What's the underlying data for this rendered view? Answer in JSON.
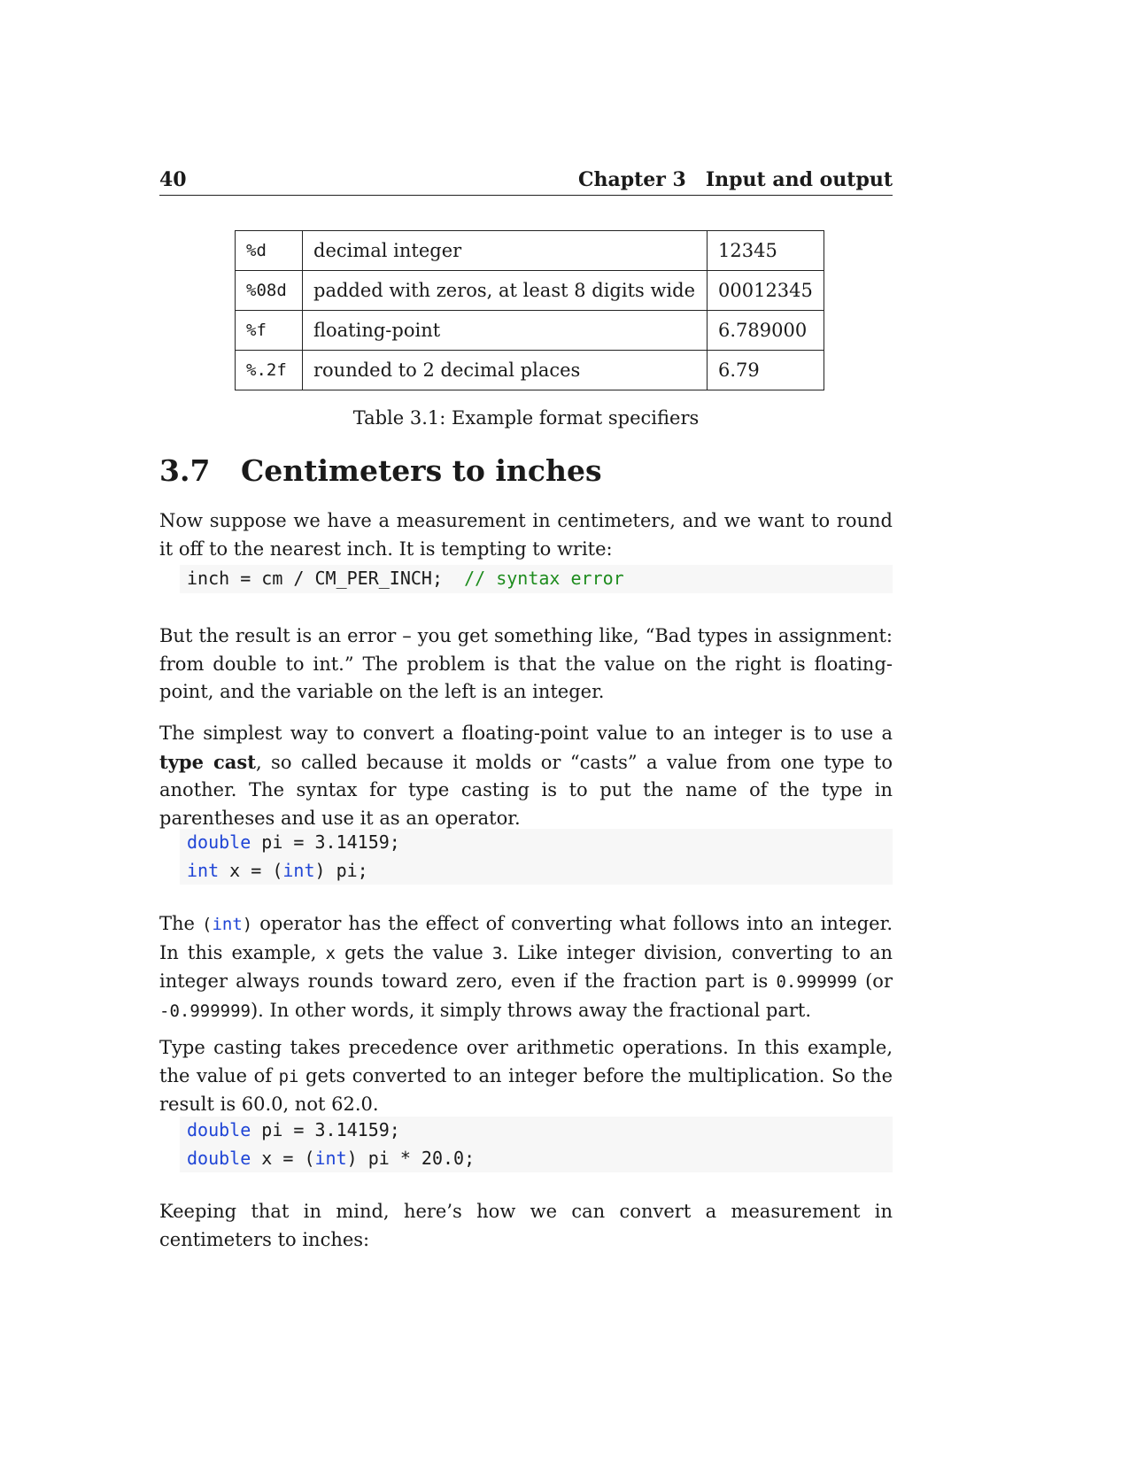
{
  "header": {
    "page_number": "40",
    "chapter_label": "Chapter 3",
    "chapter_title": "Input and output"
  },
  "format_table": {
    "rows": [
      {
        "spec": "%d",
        "desc": "decimal integer",
        "example": "12345"
      },
      {
        "spec": "%08d",
        "desc": "padded with zeros, at least 8 digits wide",
        "example": "00012345"
      },
      {
        "spec": "%f",
        "desc": "floating-point",
        "example": "6.789000"
      },
      {
        "spec": "%.2f",
        "desc": "rounded to 2 decimal places",
        "example": "6.79"
      }
    ],
    "caption": "Table 3.1: Example format specifiers"
  },
  "section": {
    "number": "3.7",
    "title": "Centimeters to inches"
  },
  "p1": {
    "text": "Now suppose we have a measurement in centimeters, and we want to round it off to the nearest inch. It is tempting to write:"
  },
  "code1": {
    "code": "inch = cm / CM_PER_INCH;",
    "comment": "// syntax error"
  },
  "p2": {
    "text": "But the result is an error – you get something like, “Bad types in assignment: from double to int.” The problem is that the value on the right is floating-point, and the variable on the left is an integer."
  },
  "p3": {
    "before": "The simplest way to convert a floating-point value to an integer is to use a",
    "term": "type cast",
    "after": ", so called because it molds or “casts” a value from one type to another. The syntax for type casting is to put the name of the type in parentheses and use it as an operator."
  },
  "code2": {
    "l1_kw": "double",
    "l1_rest": " pi = 3.14159;",
    "l2_kw": "int",
    "l2_mid": " x = (",
    "l2_kw2": "int",
    "l2_rest": ") pi;"
  },
  "p4": {
    "t1": "The ",
    "c1_open": "(",
    "c1_kw": "int",
    "c1_close": ")",
    "t2": " operator has the effect of converting what follows into an integer. In this example, ",
    "c2": "x",
    "t3": " gets the value ",
    "c3": "3",
    "t4": ". Like integer division, converting to an integer always rounds toward zero, even if the fraction part is ",
    "c4": "0.999999",
    "t5": " (or ",
    "c5": "-0.999999",
    "t6": "). In other words, it simply throws away the fractional part."
  },
  "p5": {
    "t1": "Type casting takes precedence over arithmetic operations. In this example, the value of ",
    "c1": "pi",
    "t2": " gets converted to an integer before the multiplication. So the result is 60.0, not 62.0."
  },
  "code3": {
    "l1_kw": "double",
    "l1_rest": " pi = 3.14159;",
    "l2_kw": "double",
    "l2_mid": " x = (",
    "l2_kw2": "int",
    "l2_rest": ") pi * 20.0;"
  },
  "p6": {
    "text": "Keeping that in mind, here’s how we can convert a measurement in centimeters to inches:"
  }
}
